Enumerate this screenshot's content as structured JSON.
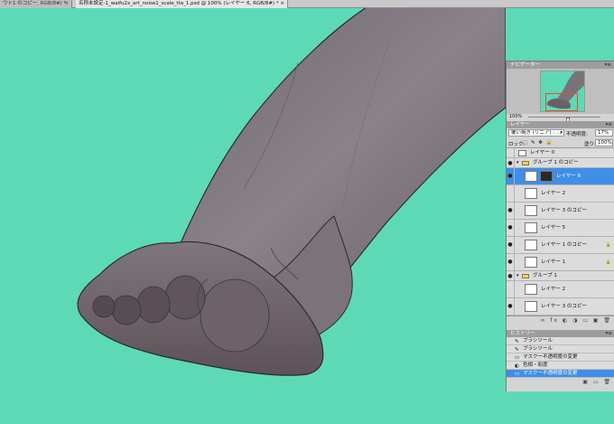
{
  "tabs": [
    {
      "label": "ウト1 のコピー, RGB/8#) *",
      "close": "×"
    },
    {
      "label": "名称未設定-1_waifu2x_art_noise1_scale_tta_1.psd @ 100% (レイヤー 6, RGB/8#) *",
      "close": "×"
    }
  ],
  "canvas": {
    "background": "#5ed9b6"
  },
  "navigator": {
    "title": "ナビゲーター",
    "menu": "▾≡",
    "zoom": "100%",
    "zoom_level": 0.55
  },
  "layers_panel": {
    "title": "レイヤー",
    "menu": "▾≡",
    "blend_mode": "覆い焼き (リニア) - ...",
    "opacity_label": "不透明度:",
    "opacity": "17%",
    "lock_label": "ロック:",
    "lock_icons": "⬚ ✎ ✥ 🔒",
    "fill_label": "塗り:",
    "fill": "100%",
    "layers": [
      {
        "name": "レイヤー 0",
        "kind": "small"
      },
      {
        "name": "グループ 1 のコピー",
        "kind": "group"
      },
      {
        "name": "レイヤー 6",
        "kind": "selected"
      },
      {
        "name": "レイヤー 2",
        "kind": "normal"
      },
      {
        "name": "レイヤー 3 のコピー",
        "kind": "normal"
      },
      {
        "name": "レイヤー 5",
        "kind": "normal"
      },
      {
        "name": "レイヤー 1 のコピー",
        "kind": "normal"
      },
      {
        "name": "レイヤー 1",
        "kind": "normal"
      },
      {
        "name": "グループ 1",
        "kind": "group"
      },
      {
        "name": "レイヤー 2",
        "kind": "normal"
      },
      {
        "name": "レイヤー 3 のコピー",
        "kind": "normal"
      }
    ],
    "footer_icons": "∞ fx ◐ ◑ ▭ ▣ 🗑"
  },
  "history_panel": {
    "title": "ヒストリー",
    "menu": "▾≡",
    "items": [
      {
        "label": "ブラシツール"
      },
      {
        "label": "ブラシツール"
      },
      {
        "label": "マスクー不透明度の変更"
      },
      {
        "label": "色相・彩度"
      },
      {
        "label": "マスクー不透明度の変更"
      }
    ],
    "footer_icons": "▣ ▭ 🗑"
  }
}
